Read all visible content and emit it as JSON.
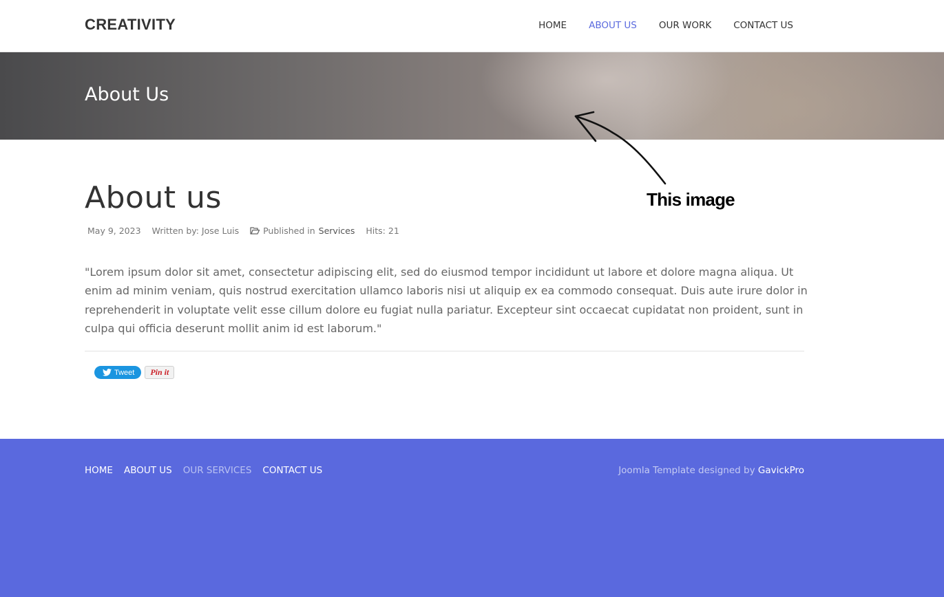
{
  "header": {
    "logo": "CREATIVITY",
    "nav": [
      {
        "label": "HOME"
      },
      {
        "label": "ABOUT US"
      },
      {
        "label": "OUR WORK"
      },
      {
        "label": "CONTACT US"
      }
    ],
    "active_nav": "ABOUT US"
  },
  "banner": {
    "title": "About Us"
  },
  "annotation": {
    "text": "This image"
  },
  "article": {
    "title": "About us",
    "date": "May 9, 2023",
    "author": "Written by: Jose Luis",
    "published_prefix": "Published in",
    "category": "Services",
    "hits": "Hits: 21",
    "body": "\"Lorem ipsum dolor sit amet, consectetur adipiscing elit, sed do eiusmod tempor incididunt ut labore et dolore magna aliqua. Ut enim ad minim veniam, quis nostrud exercitation ullamco laboris nisi ut aliquip ex ea commodo consequat. Duis aute irure dolor in reprehenderit in voluptate velit esse cillum dolore eu fugiat nulla pariatur. Excepteur sint occaecat cupidatat non proident, sunt in culpa qui officia deserunt mollit anim id est laborum.\""
  },
  "share": {
    "tweet_label": "Tweet",
    "pin_label": "Pin it"
  },
  "footer": {
    "nav": [
      {
        "label": "HOME"
      },
      {
        "label": "ABOUT US"
      },
      {
        "label": "OUR SERVICES"
      },
      {
        "label": "CONTACT US"
      }
    ],
    "credit_prefix": "Joomla Template designed by",
    "credit_link": "GavickPro"
  },
  "colors": {
    "accent": "#5a6ade",
    "footer_bg": "#5a69de",
    "tweet_bg": "#1b95e0",
    "pin_red": "#cb2027"
  },
  "icons": {
    "meta_category": "folder-open-icon",
    "tweet": "twitter-bird-icon"
  }
}
